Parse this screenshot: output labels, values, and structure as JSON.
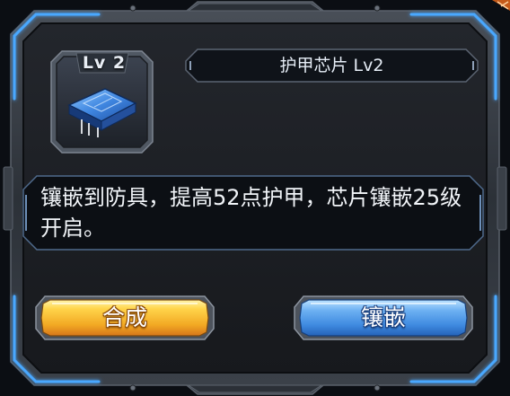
{
  "item": {
    "level_badge": "Lv 2",
    "icon": "armor-chip-icon"
  },
  "title": "护甲芯片 Lv2",
  "description": "镶嵌到防具，提高52点护甲，芯片镶嵌25级开启。",
  "buttons": {
    "synthesize_label": "合成",
    "inlay_label": "镶嵌"
  },
  "colors": {
    "panel_bg": "#1a1c21",
    "frame_metal": "#3a4048",
    "glow_blue": "#4aa8ff",
    "synth_button": "#f2a823",
    "inlay_button": "#3f8ae0"
  }
}
